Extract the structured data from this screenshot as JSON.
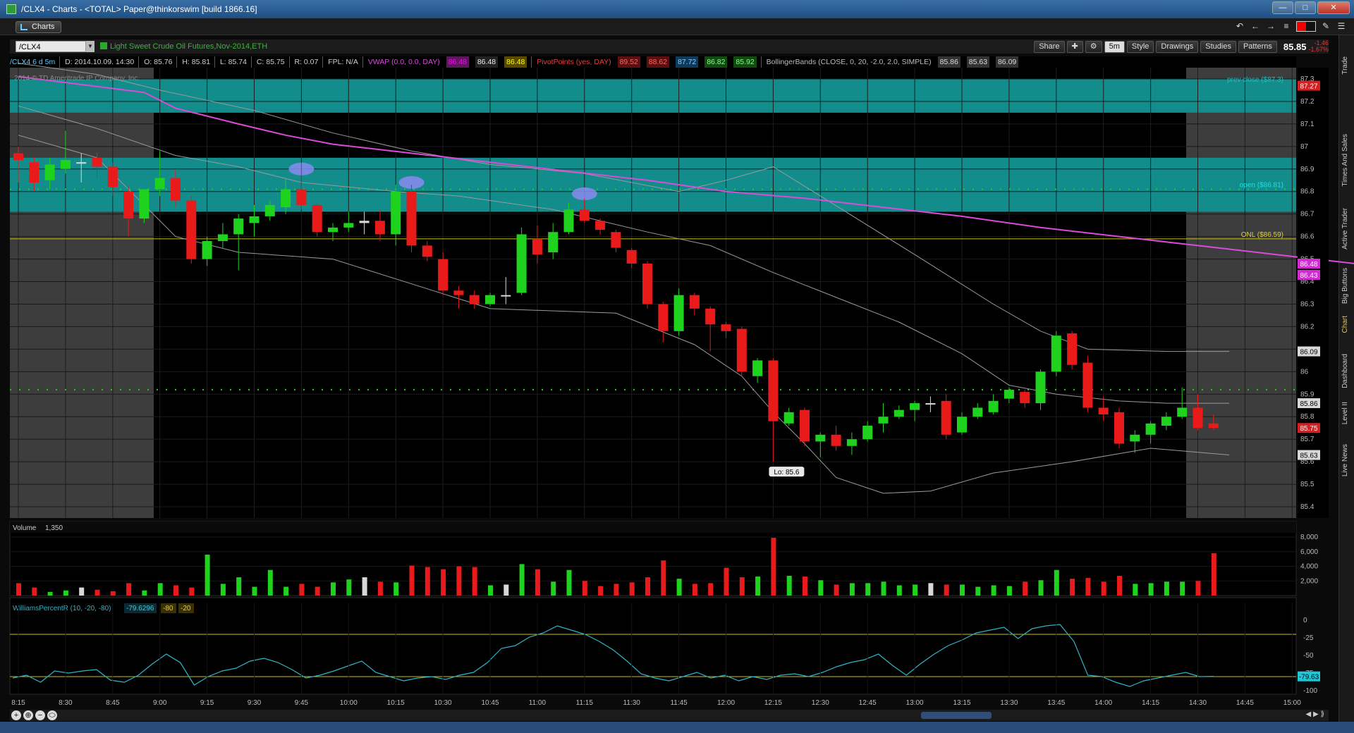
{
  "window": {
    "title": "/CLX4 - Charts - <TOTAL> Paper@thinkorswim [build 1866.16]",
    "btn_min": "—",
    "btn_max": "□",
    "btn_close": "✕"
  },
  "tab": {
    "label": "Charts"
  },
  "toolbar": {
    "symbol": "/CLX4",
    "description": "Light Sweet Crude Oil Futures,Nov-2014,ETH",
    "share": "Share",
    "period": "5m",
    "style": "Style",
    "drawings": "Drawings",
    "studies": "Studies",
    "patterns": "Patterns",
    "last_price": "85.85",
    "change": "-1.46",
    "change_pct": "-1.67%"
  },
  "infobar": {
    "symbol_period": "/CLX4 6 d 5m",
    "date": "D: 2014.10.09. 14:30",
    "open": "O: 85.76",
    "high": "H: 85.81",
    "low": "L: 85.74",
    "close": "C: 85.75",
    "range": "R: 0.07",
    "fpl": "FPL: N/A",
    "vwap_label": "VWAP (0.0, 0.0, DAY)",
    "vwap_vals": [
      "86.48",
      "86.48",
      "86.48"
    ],
    "pivot_label": "PivotPoints (yes, DAY)",
    "pivot_vals": [
      "89.52",
      "88.62",
      "87.72",
      "86.82",
      "85.92"
    ],
    "bb_label": "BollingerBands (CLOSE, 0, 20, -2.0, 2.0, SIMPLE)",
    "bb_vals": [
      "85.86",
      "85.63",
      "86.09"
    ]
  },
  "copyright": "2014 © TD Ameritrade IP Company, Inc.",
  "sidebar": [
    "Trade",
    "Times And Sales",
    "Active Trader",
    "Big Buttons",
    "Chart",
    "Dashboard",
    "Level II",
    "Live News"
  ],
  "levels": {
    "prev_close": "prev close ($87.3)",
    "open": "open ($86.81)",
    "onl": "ONL ($86.59)",
    "low_label": "Lo: 85.6"
  },
  "price_axis": {
    "ticks": [
      "87.3",
      "87.2",
      "87.1",
      "87",
      "86.9",
      "86.8",
      "86.7",
      "86.6",
      "86.5",
      "86.4",
      "86.3",
      "86.2",
      "86.1",
      "86",
      "85.9",
      "85.8",
      "85.7",
      "85.6",
      "85.5",
      "85.4"
    ],
    "bubbles": [
      {
        "label": "87.27",
        "value": 87.27,
        "color": "#d42020"
      },
      {
        "label": "86.48",
        "value": 86.48,
        "color": "#d42ad4"
      },
      {
        "label": "86.43",
        "value": 86.43,
        "color": "#d42ad4"
      },
      {
        "label": "86.09",
        "value": 86.09,
        "color": "#d8d8d8"
      },
      {
        "label": "85.86",
        "value": 85.86,
        "color": "#d8d8d8"
      },
      {
        "label": "85.75",
        "value": 85.75,
        "color": "#d42020"
      },
      {
        "label": "85.63",
        "value": 85.63,
        "color": "#d8d8d8"
      }
    ]
  },
  "time_axis": [
    "8:15",
    "8:30",
    "8:45",
    "9:00",
    "9:15",
    "9:30",
    "9:45",
    "10:00",
    "10:15",
    "10:30",
    "10:45",
    "11:00",
    "11:15",
    "11:30",
    "11:45",
    "12:00",
    "12:15",
    "12:30",
    "12:45",
    "13:00",
    "13:15",
    "13:30",
    "13:45",
    "14:00",
    "14:15",
    "14:30",
    "14:45",
    "15:00"
  ],
  "volume": {
    "label": "Volume",
    "value": "1,350",
    "ticks": [
      "8,000",
      "6,000",
      "4,000",
      "2,000"
    ]
  },
  "williams": {
    "label": "WilliamsPercentR (10, -20, -80)",
    "value": "-79.6296",
    "ob": "-80",
    "os": "-20",
    "ticks": [
      "0",
      "-25",
      "-50",
      "-75",
      "-100"
    ],
    "bubble": "-79.63"
  },
  "colors": {
    "up": "#1ed21e",
    "down": "#e81a1a",
    "teal": "#138c8c",
    "vwap": "#d84cd8",
    "bands": "#9a9a9a",
    "willr": "#2fb5c8"
  },
  "chart_data": {
    "type": "candlestick",
    "title": "/CLX4 6 d 5m",
    "xlabel": "",
    "ylabel": "",
    "ylim": [
      85.35,
      87.35
    ],
    "candles": [
      {
        "t": "8:15",
        "o": 86.97,
        "h": 87.0,
        "l": 86.84,
        "c": 86.94
      },
      {
        "t": "8:20",
        "o": 86.93,
        "h": 86.95,
        "l": 86.8,
        "c": 86.84
      },
      {
        "t": "8:25",
        "o": 86.85,
        "h": 86.95,
        "l": 86.81,
        "c": 86.92
      },
      {
        "t": "8:30",
        "o": 86.9,
        "h": 87.07,
        "l": 86.88,
        "c": 86.94
      },
      {
        "t": "8:35",
        "o": 86.93,
        "h": 86.97,
        "l": 86.84,
        "c": 86.93
      },
      {
        "t": "8:40",
        "o": 86.95,
        "h": 86.97,
        "l": 86.86,
        "c": 86.91
      },
      {
        "t": "8:45",
        "o": 86.91,
        "h": 86.93,
        "l": 86.78,
        "c": 86.82
      },
      {
        "t": "8:50",
        "o": 86.8,
        "h": 86.82,
        "l": 86.6,
        "c": 86.68
      },
      {
        "t": "8:55",
        "o": 86.68,
        "h": 86.81,
        "l": 86.66,
        "c": 86.81
      },
      {
        "t": "9:00",
        "o": 86.81,
        "h": 86.98,
        "l": 86.78,
        "c": 86.86
      },
      {
        "t": "9:05",
        "o": 86.86,
        "h": 86.9,
        "l": 86.73,
        "c": 86.76
      },
      {
        "t": "9:10",
        "o": 86.76,
        "h": 86.78,
        "l": 86.48,
        "c": 86.5
      },
      {
        "t": "9:15",
        "o": 86.5,
        "h": 86.6,
        "l": 86.47,
        "c": 86.58
      },
      {
        "t": "9:20",
        "o": 86.58,
        "h": 86.66,
        "l": 86.55,
        "c": 86.61
      },
      {
        "t": "9:25",
        "o": 86.61,
        "h": 86.7,
        "l": 86.45,
        "c": 86.68
      },
      {
        "t": "9:30",
        "o": 86.66,
        "h": 86.74,
        "l": 86.6,
        "c": 86.69
      },
      {
        "t": "9:35",
        "o": 86.69,
        "h": 86.76,
        "l": 86.67,
        "c": 86.74
      },
      {
        "t": "9:40",
        "o": 86.73,
        "h": 86.86,
        "l": 86.7,
        "c": 86.81
      },
      {
        "t": "9:45",
        "o": 86.81,
        "h": 86.93,
        "l": 86.72,
        "c": 86.74
      },
      {
        "t": "9:50",
        "o": 86.74,
        "h": 86.75,
        "l": 86.6,
        "c": 86.62
      },
      {
        "t": "9:55",
        "o": 86.62,
        "h": 86.66,
        "l": 86.58,
        "c": 86.64
      },
      {
        "t": "10:00",
        "o": 86.64,
        "h": 86.71,
        "l": 86.62,
        "c": 86.66
      },
      {
        "t": "10:05",
        "o": 86.66,
        "h": 86.71,
        "l": 86.61,
        "c": 86.67
      },
      {
        "t": "10:10",
        "o": 86.67,
        "h": 86.72,
        "l": 86.58,
        "c": 86.61
      },
      {
        "t": "10:15",
        "o": 86.61,
        "h": 86.83,
        "l": 86.56,
        "c": 86.8
      },
      {
        "t": "10:20",
        "o": 86.8,
        "h": 86.83,
        "l": 86.53,
        "c": 86.56
      },
      {
        "t": "10:25",
        "o": 86.56,
        "h": 86.58,
        "l": 86.49,
        "c": 86.51
      },
      {
        "t": "10:30",
        "o": 86.5,
        "h": 86.53,
        "l": 86.34,
        "c": 86.36
      },
      {
        "t": "10:35",
        "o": 86.36,
        "h": 86.38,
        "l": 86.28,
        "c": 86.34
      },
      {
        "t": "10:40",
        "o": 86.34,
        "h": 86.36,
        "l": 86.28,
        "c": 86.3
      },
      {
        "t": "10:45",
        "o": 86.3,
        "h": 86.35,
        "l": 86.29,
        "c": 86.34
      },
      {
        "t": "10:50",
        "o": 86.34,
        "h": 86.42,
        "l": 86.3,
        "c": 86.34
      },
      {
        "t": "10:55",
        "o": 86.35,
        "h": 86.64,
        "l": 86.34,
        "c": 86.61
      },
      {
        "t": "11:00",
        "o": 86.59,
        "h": 86.65,
        "l": 86.48,
        "c": 86.52
      },
      {
        "t": "11:05",
        "o": 86.53,
        "h": 86.66,
        "l": 86.5,
        "c": 86.62
      },
      {
        "t": "11:10",
        "o": 86.62,
        "h": 86.75,
        "l": 86.61,
        "c": 86.72
      },
      {
        "t": "11:15",
        "o": 86.72,
        "h": 86.77,
        "l": 86.66,
        "c": 86.67
      },
      {
        "t": "11:20",
        "o": 86.67,
        "h": 86.68,
        "l": 86.61,
        "c": 86.63
      },
      {
        "t": "11:25",
        "o": 86.62,
        "h": 86.63,
        "l": 86.53,
        "c": 86.55
      },
      {
        "t": "11:30",
        "o": 86.54,
        "h": 86.55,
        "l": 86.46,
        "c": 86.48
      },
      {
        "t": "11:35",
        "o": 86.48,
        "h": 86.49,
        "l": 86.28,
        "c": 86.3
      },
      {
        "t": "11:40",
        "o": 86.3,
        "h": 86.31,
        "l": 86.13,
        "c": 86.18
      },
      {
        "t": "11:45",
        "o": 86.18,
        "h": 86.37,
        "l": 86.16,
        "c": 86.34
      },
      {
        "t": "11:50",
        "o": 86.34,
        "h": 86.35,
        "l": 86.25,
        "c": 86.28
      },
      {
        "t": "11:55",
        "o": 86.28,
        "h": 86.29,
        "l": 86.09,
        "c": 86.21
      },
      {
        "t": "12:00",
        "o": 86.21,
        "h": 86.22,
        "l": 86.15,
        "c": 86.18
      },
      {
        "t": "12:05",
        "o": 86.19,
        "h": 86.2,
        "l": 85.98,
        "c": 86.0
      },
      {
        "t": "12:10",
        "o": 85.98,
        "h": 86.06,
        "l": 85.95,
        "c": 86.05
      },
      {
        "t": "12:15",
        "o": 86.05,
        "h": 86.06,
        "l": 85.6,
        "c": 85.78
      },
      {
        "t": "12:20",
        "o": 85.77,
        "h": 85.84,
        "l": 85.76,
        "c": 85.82
      },
      {
        "t": "12:25",
        "o": 85.83,
        "h": 85.84,
        "l": 85.67,
        "c": 85.69
      },
      {
        "t": "12:30",
        "o": 85.69,
        "h": 85.73,
        "l": 85.62,
        "c": 85.72
      },
      {
        "t": "12:35",
        "o": 85.72,
        "h": 85.76,
        "l": 85.65,
        "c": 85.67
      },
      {
        "t": "12:40",
        "o": 85.67,
        "h": 85.73,
        "l": 85.63,
        "c": 85.7
      },
      {
        "t": "12:45",
        "o": 85.7,
        "h": 85.78,
        "l": 85.69,
        "c": 85.76
      },
      {
        "t": "12:50",
        "o": 85.77,
        "h": 85.86,
        "l": 85.73,
        "c": 85.8
      },
      {
        "t": "12:55",
        "o": 85.8,
        "h": 85.85,
        "l": 85.79,
        "c": 85.83
      },
      {
        "t": "13:00",
        "o": 85.83,
        "h": 85.87,
        "l": 85.78,
        "c": 85.86
      },
      {
        "t": "13:05",
        "o": 85.86,
        "h": 85.89,
        "l": 85.82,
        "c": 85.86
      },
      {
        "t": "13:10",
        "o": 85.87,
        "h": 85.9,
        "l": 85.7,
        "c": 85.72
      },
      {
        "t": "13:15",
        "o": 85.73,
        "h": 85.82,
        "l": 85.72,
        "c": 85.8
      },
      {
        "t": "13:20",
        "o": 85.8,
        "h": 85.86,
        "l": 85.79,
        "c": 85.84
      },
      {
        "t": "13:25",
        "o": 85.82,
        "h": 85.9,
        "l": 85.81,
        "c": 85.87
      },
      {
        "t": "13:30",
        "o": 85.88,
        "h": 85.93,
        "l": 85.86,
        "c": 85.92
      },
      {
        "t": "13:35",
        "o": 85.91,
        "h": 85.92,
        "l": 85.84,
        "c": 85.86
      },
      {
        "t": "13:40",
        "o": 85.86,
        "h": 86.01,
        "l": 85.83,
        "c": 86.0
      },
      {
        "t": "13:45",
        "o": 86.0,
        "h": 86.18,
        "l": 85.98,
        "c": 86.16
      },
      {
        "t": "13:50",
        "o": 86.17,
        "h": 86.18,
        "l": 86.01,
        "c": 86.03
      },
      {
        "t": "13:55",
        "o": 86.04,
        "h": 86.07,
        "l": 85.82,
        "c": 85.84
      },
      {
        "t": "14:00",
        "o": 85.84,
        "h": 85.89,
        "l": 85.78,
        "c": 85.81
      },
      {
        "t": "14:05",
        "o": 85.82,
        "h": 85.84,
        "l": 85.66,
        "c": 85.68
      },
      {
        "t": "14:10",
        "o": 85.69,
        "h": 85.74,
        "l": 85.64,
        "c": 85.72
      },
      {
        "t": "14:15",
        "o": 85.72,
        "h": 85.78,
        "l": 85.68,
        "c": 85.77
      },
      {
        "t": "14:20",
        "o": 85.76,
        "h": 85.82,
        "l": 85.74,
        "c": 85.8
      },
      {
        "t": "14:25",
        "o": 85.8,
        "h": 85.93,
        "l": 85.79,
        "c": 85.84
      },
      {
        "t": "14:30",
        "o": 85.84,
        "h": 85.9,
        "l": 85.74,
        "c": 85.75
      },
      {
        "t": "14:35",
        "o": 85.77,
        "h": 85.81,
        "l": 85.74,
        "c": 85.75
      }
    ],
    "volume": [
      1700,
      1100,
      500,
      700,
      1100,
      800,
      600,
      1700,
      700,
      1700,
      1400,
      1100,
      5600,
      1600,
      2500,
      1200,
      3500,
      1200,
      1600,
      1200,
      1800,
      2200,
      2500,
      1900,
      1800,
      4100,
      3900,
      3600,
      4000,
      3900,
      1400,
      1500,
      4300,
      3600,
      1900,
      3500,
      2000,
      1300,
      1600,
      1800,
      2500,
      4800,
      2300,
      1600,
      1700,
      3800,
      2500,
      2600,
      7900,
      2700,
      2600,
      2100,
      1500,
      1700,
      1700,
      1900,
      1400,
      1500,
      1700,
      1500,
      1500,
      1200,
      1400,
      1300,
      1900,
      2100,
      3500,
      2300,
      2400,
      1900,
      2700,
      1600,
      1700,
      1900,
      1900,
      2000,
      5800,
      1200
    ],
    "williams_r": [
      -82,
      -78,
      -88,
      -72,
      -75,
      -72,
      -70,
      -85,
      -88,
      -78,
      -62,
      -48,
      -60,
      -92,
      -80,
      -72,
      -68,
      -58,
      -54,
      -60,
      -70,
      -82,
      -78,
      -72,
      -65,
      -58,
      -74,
      -80,
      -86,
      -82,
      -80,
      -84,
      -78,
      -74,
      -60,
      -40,
      -36,
      -24,
      -18,
      -8,
      -14,
      -20,
      -30,
      -42,
      -58,
      -76,
      -82,
      -86,
      -80,
      -74,
      -82,
      -78,
      -86,
      -80,
      -84,
      -78,
      -76,
      -80,
      -74,
      -66,
      -60,
      -56,
      -48,
      -64,
      -78,
      -62,
      -48,
      -36,
      -28,
      -18,
      -14,
      -10,
      -26,
      -12,
      -8,
      -6,
      -30,
      -78,
      -80,
      -88,
      -94,
      -86,
      -82,
      -78,
      -74,
      -80,
      -79.63
    ],
    "vwap": [
      [
        0,
        87.31
      ],
      [
        8,
        87.24
      ],
      [
        10,
        87.17
      ],
      [
        14,
        87.1
      ],
      [
        17,
        87.05
      ],
      [
        20,
        87.01
      ],
      [
        25,
        86.97
      ],
      [
        30,
        86.93
      ],
      [
        35,
        86.89
      ],
      [
        40,
        86.85
      ],
      [
        45,
        86.8
      ],
      [
        50,
        86.77
      ],
      [
        55,
        86.73
      ],
      [
        60,
        86.69
      ],
      [
        65,
        86.64
      ],
      [
        70,
        86.6
      ],
      [
        75,
        86.56
      ],
      [
        80,
        86.52
      ],
      [
        85,
        86.48
      ],
      [
        87,
        86.43
      ]
    ],
    "bb_upper": [
      [
        0,
        87.37
      ],
      [
        5,
        87.32
      ],
      [
        9,
        87.25
      ],
      [
        15,
        87.16
      ],
      [
        20,
        87.06
      ],
      [
        25,
        86.98
      ],
      [
        30,
        86.92
      ],
      [
        36,
        86.88
      ],
      [
        42,
        86.8
      ],
      [
        45,
        86.85
      ],
      [
        48,
        86.91
      ],
      [
        51,
        86.78
      ],
      [
        57,
        86.52
      ],
      [
        62,
        86.3
      ],
      [
        65,
        86.18
      ],
      [
        68,
        86.1
      ],
      [
        73,
        86.09
      ],
      [
        77,
        86.09
      ]
    ],
    "bb_mid": [
      [
        0,
        87.18
      ],
      [
        5,
        87.08
      ],
      [
        10,
        86.96
      ],
      [
        14,
        86.91
      ],
      [
        18,
        86.84
      ],
      [
        24,
        86.8
      ],
      [
        28,
        86.78
      ],
      [
        34,
        86.72
      ],
      [
        40,
        86.62
      ],
      [
        44,
        86.56
      ],
      [
        48,
        86.44
      ],
      [
        52,
        86.33
      ],
      [
        56,
        86.22
      ],
      [
        60,
        86.08
      ],
      [
        63,
        85.94
      ],
      [
        66,
        85.9
      ],
      [
        70,
        85.87
      ],
      [
        73,
        85.86
      ],
      [
        77,
        85.86
      ]
    ],
    "bb_lower": [
      [
        0,
        87.05
      ],
      [
        5,
        86.95
      ],
      [
        10,
        86.6
      ],
      [
        14,
        86.53
      ],
      [
        20,
        86.5
      ],
      [
        25,
        86.39
      ],
      [
        30,
        86.28
      ],
      [
        38,
        86.26
      ],
      [
        43,
        86.12
      ],
      [
        46,
        85.98
      ],
      [
        48,
        85.82
      ],
      [
        50,
        85.68
      ],
      [
        52,
        85.53
      ],
      [
        55,
        85.46
      ],
      [
        58,
        85.47
      ],
      [
        62,
        85.55
      ],
      [
        67,
        85.6
      ],
      [
        72,
        85.66
      ],
      [
        77,
        85.63
      ]
    ]
  }
}
